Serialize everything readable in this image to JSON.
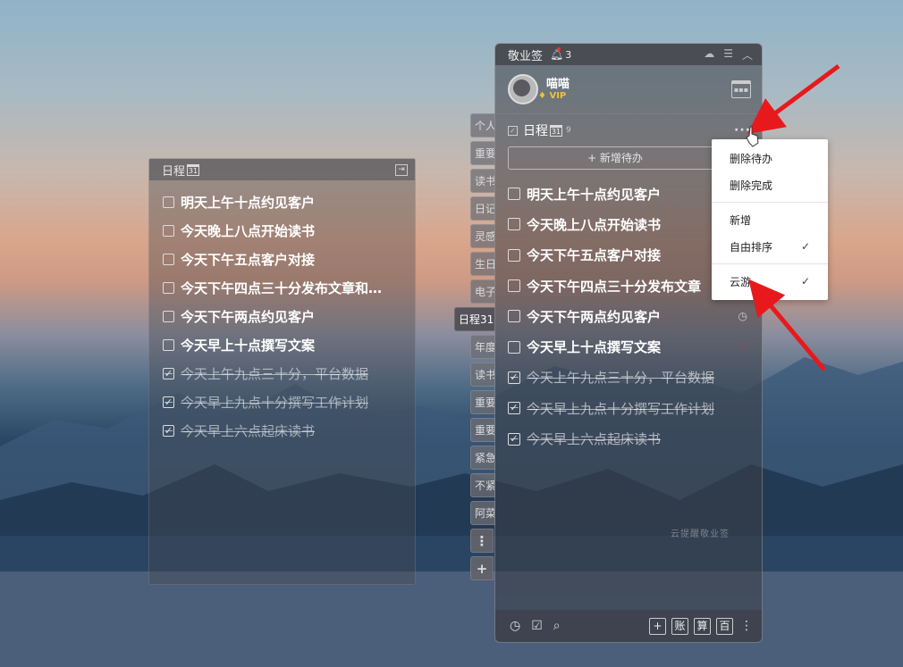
{
  "left_panel": {
    "title": "日程",
    "cal_day": "31",
    "exit_icon": "⇥",
    "items": [
      {
        "text": "明天上午十点约见客户",
        "done": false
      },
      {
        "text": "今天晚上八点开始读书",
        "done": false
      },
      {
        "text": "今天下午五点客户对接",
        "done": false
      },
      {
        "text": "今天下午四点三十分发布文章和…",
        "done": false
      },
      {
        "text": "今天下午两点约见客户",
        "done": false
      },
      {
        "text": "今天早上十点撰写文案",
        "done": false
      },
      {
        "text": "今天上午九点三十分，平台数据",
        "done": true
      },
      {
        "text": "今天早上九点十分撰写工作计划",
        "done": true
      },
      {
        "text": "今天早上六点起床读书",
        "done": true
      }
    ]
  },
  "tabs": [
    {
      "label": "个人"
    },
    {
      "label": "重要"
    },
    {
      "label": "读书"
    },
    {
      "label": "日记"
    },
    {
      "label": "灵感"
    },
    {
      "label": "生日"
    },
    {
      "label": "电子"
    },
    {
      "label": "日程31",
      "active": true
    },
    {
      "label": "年度"
    },
    {
      "label": "读书"
    },
    {
      "label": "重要"
    },
    {
      "label": "重要"
    },
    {
      "label": "紧急"
    },
    {
      "label": "不紧"
    },
    {
      "label": "阿菜"
    },
    {
      "label": "⋮"
    },
    {
      "label": "+"
    }
  ],
  "app": {
    "title": "敬业签",
    "notify_count": "3",
    "user": {
      "name": "喵喵",
      "badge": "VIP"
    },
    "schedule": {
      "title": "日程",
      "cal_day": "31",
      "count": "9",
      "more": "···"
    },
    "add_button": "+ 新增待办",
    "items": [
      {
        "text": "明天上午十点约见客户",
        "done": false,
        "tail": ""
      },
      {
        "text": "今天晚上八点开始读书",
        "done": false,
        "tail": ""
      },
      {
        "text": "今天下午五点客户对接",
        "done": false,
        "tail": ""
      },
      {
        "text": "今天下午四点三十分发布文章",
        "done": false,
        "tail": ""
      },
      {
        "text": "今天下午两点约见客户",
        "done": false,
        "tail": "◷"
      },
      {
        "text": "今天早上十点撰写文案",
        "done": false,
        "tail": "♡"
      },
      {
        "text": "今天上午九点三十分，平台数据",
        "done": true,
        "tail": ""
      },
      {
        "text": "今天早上九点十分撰写工作计划",
        "done": true,
        "tail": ""
      },
      {
        "text": "今天早上六点起床读书",
        "done": true,
        "tail": ""
      }
    ],
    "watermark": "云提醒敬业签",
    "bottom": {
      "b1": "账",
      "b2": "算",
      "b3": "百"
    }
  },
  "menu": {
    "items": [
      {
        "label": "删除待办",
        "check": ""
      },
      {
        "label": "删除完成",
        "check": ""
      },
      {
        "label": "新增",
        "check": ""
      },
      {
        "label": "自由排序",
        "check": "✓"
      },
      {
        "label": "云游",
        "check": "✓"
      }
    ]
  },
  "colors": {
    "arrow": "#e8191c",
    "vip": "#f2c230"
  }
}
